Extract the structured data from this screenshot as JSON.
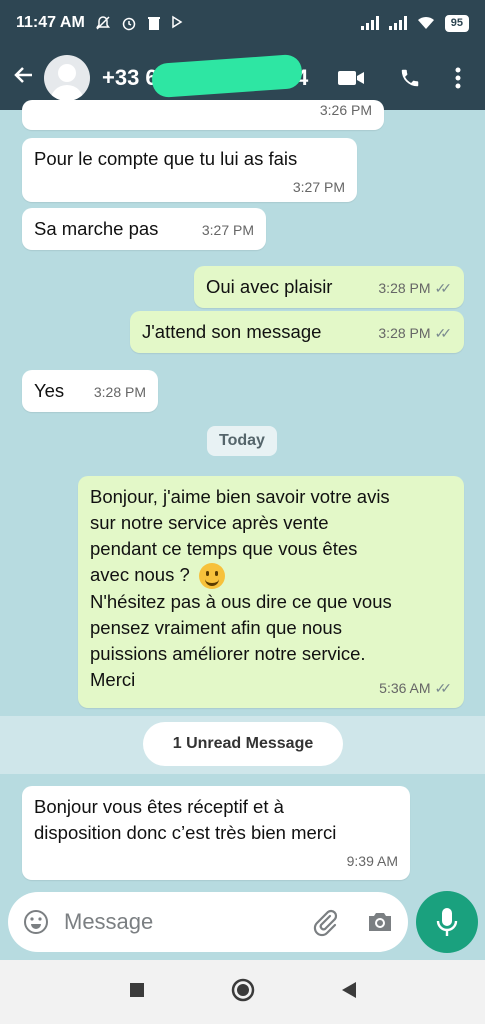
{
  "status_bar": {
    "time": "11:47 AM",
    "battery": "95"
  },
  "header": {
    "contact_name": "+33 6",
    "contact_tail": "94"
  },
  "messages": [
    {
      "dir": "in",
      "text": "",
      "time": "3:26 PM"
    },
    {
      "dir": "in",
      "text": "Pour le compte que tu lui as fais",
      "time": "3:27 PM"
    },
    {
      "dir": "in",
      "text": "Sa marche pas",
      "time": "3:27 PM"
    },
    {
      "dir": "out",
      "text": "Oui avec plaisir",
      "time": "3:28 PM"
    },
    {
      "dir": "out",
      "text": "J'attend son message",
      "time": "3:28 PM"
    },
    {
      "dir": "in",
      "text": "Yes",
      "time": "3:28 PM"
    },
    {
      "dir": "out",
      "lines": [
        "Bonjour, j'aime bien savoir votre avis",
        "sur notre service après vente",
        "pendant ce temps que vous êtes",
        "avec nous ?",
        "N'hésitez pas à ous dire ce que vous",
        "pensez vraiment afin que nous",
        "puissions améliorer notre service.",
        "Merci"
      ],
      "time": "5:36 AM"
    },
    {
      "dir": "in",
      "lines": [
        "Bonjour vous êtes réceptif et à",
        "disposition donc c’est très bien merci"
      ],
      "time": "9:39 AM"
    }
  ],
  "day_divider": "Today",
  "unread_label": "1 Unread Message",
  "composer": {
    "placeholder": "Message"
  },
  "icons": {
    "status": [
      "notification-off-icon",
      "alarm-icon",
      "trash-icon",
      "play-icon",
      "signal-icon",
      "wifi-icon",
      "battery-icon"
    ],
    "header": [
      "back-arrow-icon",
      "video-call-icon",
      "phone-icon",
      "more-vert-icon"
    ],
    "composer": [
      "emoji-icon",
      "attach-icon",
      "camera-icon",
      "mic-icon"
    ],
    "nav": [
      "recents-square-icon",
      "home-circle-icon",
      "back-triangle-icon"
    ]
  },
  "colors": {
    "header": "#2e4653",
    "chat_bg": "#b7dbe0",
    "outgoing": "#e3f8c8",
    "incoming": "#ffffff",
    "accent": "#1aa17e"
  }
}
